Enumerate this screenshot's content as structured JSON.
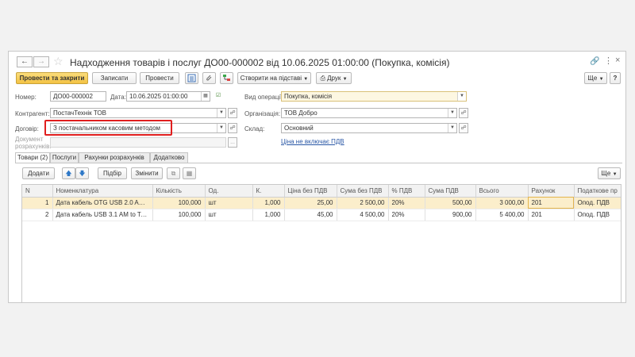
{
  "window": {
    "title": "Надходження товарів і послуг ДО00-000002 від 10.06.2025 01:00:00 (Покупка, комісія)"
  },
  "toolbar": {
    "post_close": "Провести та закрити",
    "save": "Записати",
    "post": "Провести",
    "create_based": "Створити на підставі",
    "print": "Друк",
    "more": "Ще"
  },
  "form": {
    "number_label": "Номер:",
    "number_value": "ДО00-000002",
    "date_label": "Дата:",
    "date_value": "10.06.2025 01:00:00",
    "operation_label": "Вид операції:",
    "operation_value": "Покупка, комісія",
    "counterparty_label": "Контрагент:",
    "counterparty_value": "ПостачТехнік ТОВ",
    "organization_label": "Організація:",
    "organization_value": "ТОВ Добро",
    "contract_label": "Договір:",
    "contract_value": "З постачальником касовим методом",
    "warehouse_label": "Склад:",
    "warehouse_value": "Основний",
    "settlement_doc_label_1": "Документ",
    "settlement_doc_label_2": "розрахунків:",
    "price_link": "Ціна не включає ПДВ"
  },
  "tabs": [
    "Товари (2)",
    "Послуги",
    "Рахунки розрахунків",
    "Додатково"
  ],
  "table_toolbar": {
    "add": "Додати",
    "pick": "Підбір",
    "change": "Змінити",
    "more": "Ще"
  },
  "table": {
    "columns": [
      "N",
      "Номенклатура",
      "Кількість",
      "Од.",
      "К.",
      "Ціна без ПДВ",
      "Сума без ПДВ",
      "% ПДВ",
      "Сума ПДВ",
      "Всього",
      "Рахунок",
      "Податкове пр"
    ],
    "rows": [
      [
        "1",
        "Дата кабель OTG USB 2.0 AF to...",
        "100,000",
        "шт",
        "1,000",
        "25,00",
        "2 500,00",
        "20%",
        "500,00",
        "3 000,00",
        "201",
        "Опод. ПДВ"
      ],
      [
        "2",
        "Дата кабель USB 3.1 AM to Typ...",
        "100,000",
        "шт",
        "1,000",
        "45,00",
        "4 500,00",
        "20%",
        "900,00",
        "5 400,00",
        "201",
        "Опод. ПДВ"
      ]
    ]
  }
}
